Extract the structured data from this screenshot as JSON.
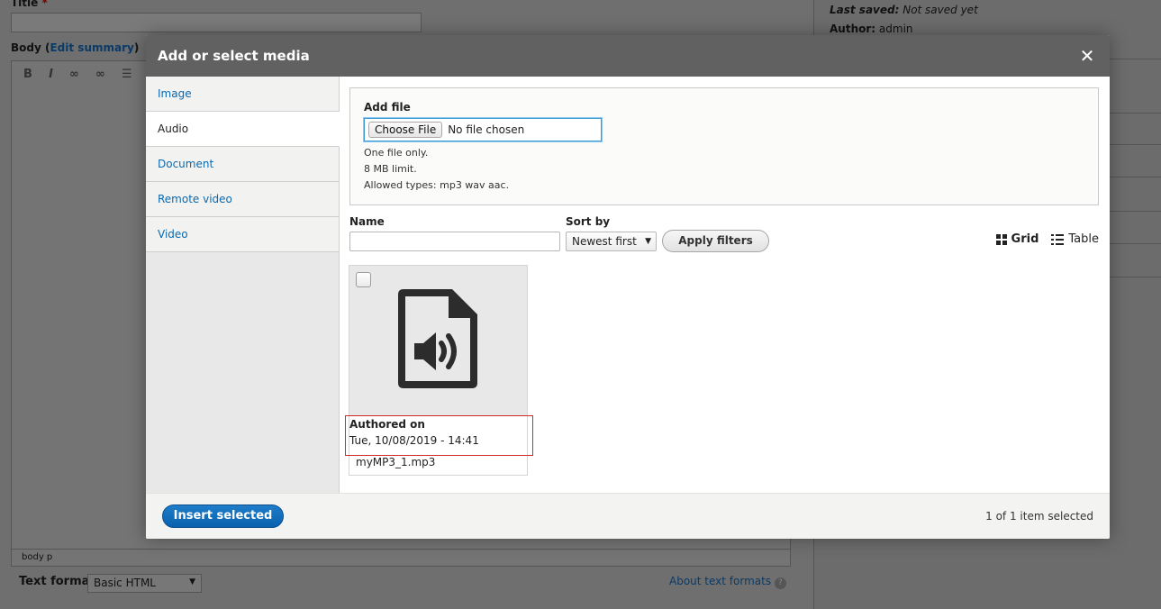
{
  "background": {
    "title_label": "Title",
    "required_mark": "*",
    "body_label": "Body",
    "edit_summary": "Edit summary",
    "toolbar": {
      "bold": "B",
      "italic": "I"
    },
    "path": "body   p",
    "text_format_label": "Text format",
    "text_format_value": "Basic HTML",
    "about_text_formats": "About text formats",
    "last_saved_label": "Last saved:",
    "last_saved_value": "Not saved yet",
    "author_label": "Author:",
    "author_value": "admin"
  },
  "modal": {
    "title": "Add or select media",
    "close_symbol": "✕",
    "tabs": [
      {
        "label": "Image",
        "active": false
      },
      {
        "label": "Audio",
        "active": true
      },
      {
        "label": "Document",
        "active": false
      },
      {
        "label": "Remote video",
        "active": false
      },
      {
        "label": "Video",
        "active": false
      }
    ],
    "add_file": {
      "label": "Add file",
      "choose_button": "Choose File",
      "no_file": "No file chosen",
      "help": [
        "One file only.",
        "8 MB limit.",
        "Allowed types: mp3 wav aac."
      ]
    },
    "filters": {
      "name_label": "Name",
      "name_value": "",
      "sort_label": "Sort by",
      "sort_value": "Newest first",
      "apply_button": "Apply filters",
      "view_grid": "Grid",
      "view_table": "Table"
    },
    "media_item": {
      "authored_label": "Authored on",
      "authored_value": "Tue, 10/08/2019 - 14:41",
      "filename": "myMP3_1.mp3",
      "icon": "audio-file-icon"
    },
    "footer": {
      "insert_button": "Insert selected",
      "selected_count": "1 of 1 item selected"
    }
  },
  "colors": {
    "accent": "#0b69b0",
    "header_bg": "#616161",
    "highlight_border": "#d02b2b"
  }
}
